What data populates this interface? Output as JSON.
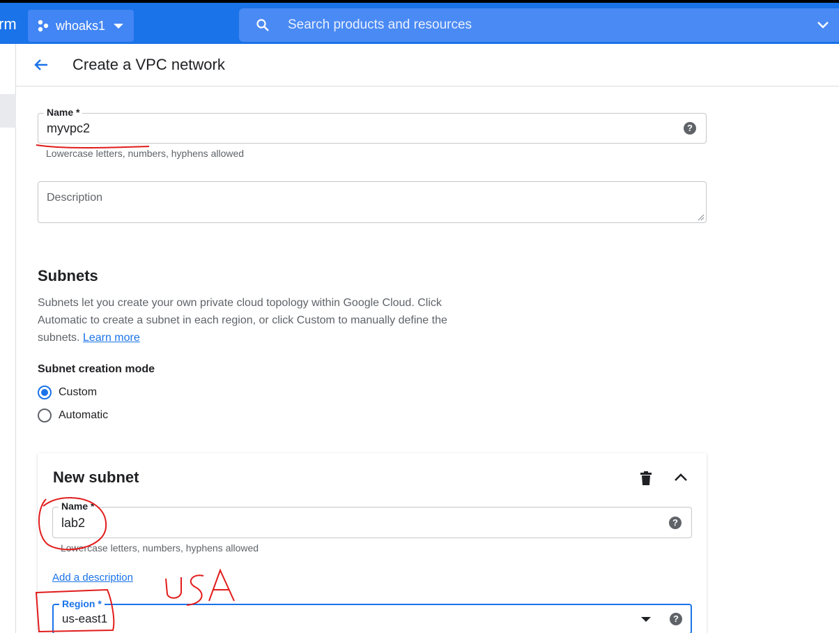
{
  "topbar": {
    "brand_fragment": "rm",
    "project_name": "whoaks1",
    "search_placeholder": "Search products and resources"
  },
  "header": {
    "title": "Create a VPC network"
  },
  "network_name": {
    "label": "Name *",
    "value": "myvpc2",
    "hint": "Lowercase letters, numbers, hyphens allowed"
  },
  "description": {
    "placeholder": "Description"
  },
  "subnets": {
    "title": "Subnets",
    "text": "Subnets let you create your own private cloud topology within Google Cloud. Click Automatic to create a subnet in each region, or click Custom to manually define the subnets.",
    "learn_more": "Learn more",
    "mode_label": "Subnet creation mode",
    "modes": [
      {
        "label": "Custom",
        "selected": true
      },
      {
        "label": "Automatic",
        "selected": false
      }
    ]
  },
  "new_subnet": {
    "title": "New subnet",
    "name_label": "Name *",
    "name_value": "lab2",
    "name_hint": "Lowercase letters, numbers, hyphens allowed",
    "add_description": "Add a description",
    "region_label": "Region *",
    "region_value": "us-east1"
  },
  "annotation": {
    "handwritten_text": "USA",
    "ink_color": "#e21b1b"
  },
  "colors": {
    "primary": "#1a73e8",
    "topbar": "#1a73e8",
    "annotation_red": "#e21b1b"
  }
}
